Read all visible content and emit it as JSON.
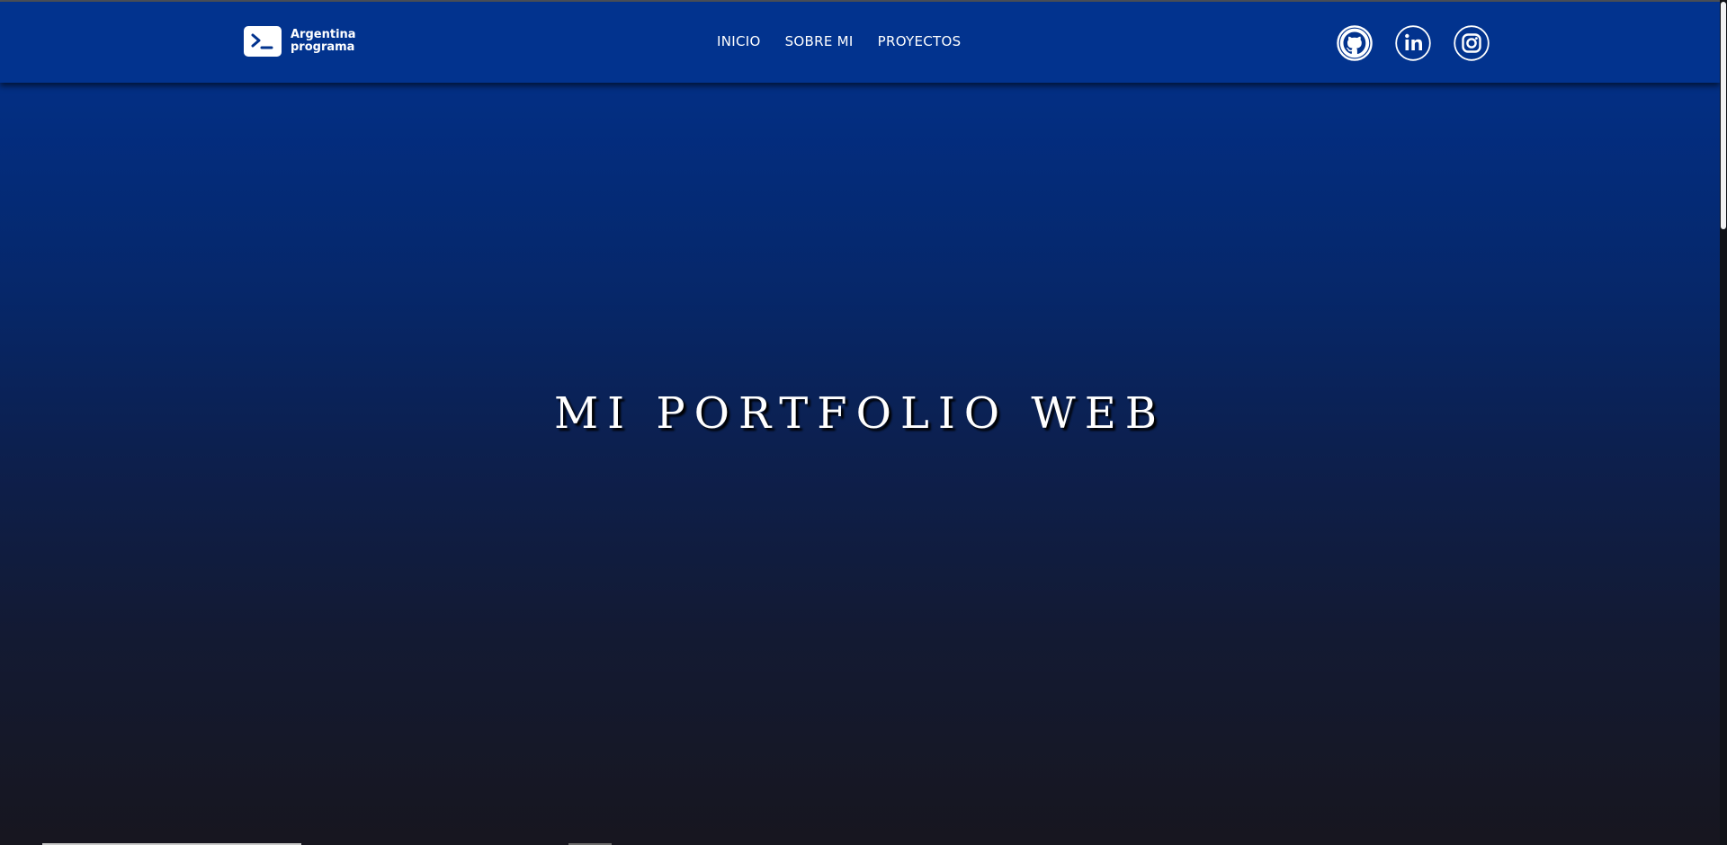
{
  "brand": {
    "line1": "Argentina",
    "line2": "programa",
    "icon": "terminal-icon"
  },
  "nav": {
    "items": [
      {
        "label": "INICIO"
      },
      {
        "label": "SOBRE MI"
      },
      {
        "label": "PROYECTOS"
      }
    ]
  },
  "socials": [
    {
      "name": "github",
      "icon": "github-icon"
    },
    {
      "name": "linkedin",
      "icon": "linkedin-icon"
    },
    {
      "name": "instagram",
      "icon": "instagram-icon"
    }
  ],
  "hero": {
    "title": "MI PORTFOLIO WEB"
  },
  "colors": {
    "navbar": "#02338e",
    "gradient_top": "#02338e",
    "gradient_bottom": "#17161f",
    "text": "#ffffff"
  }
}
